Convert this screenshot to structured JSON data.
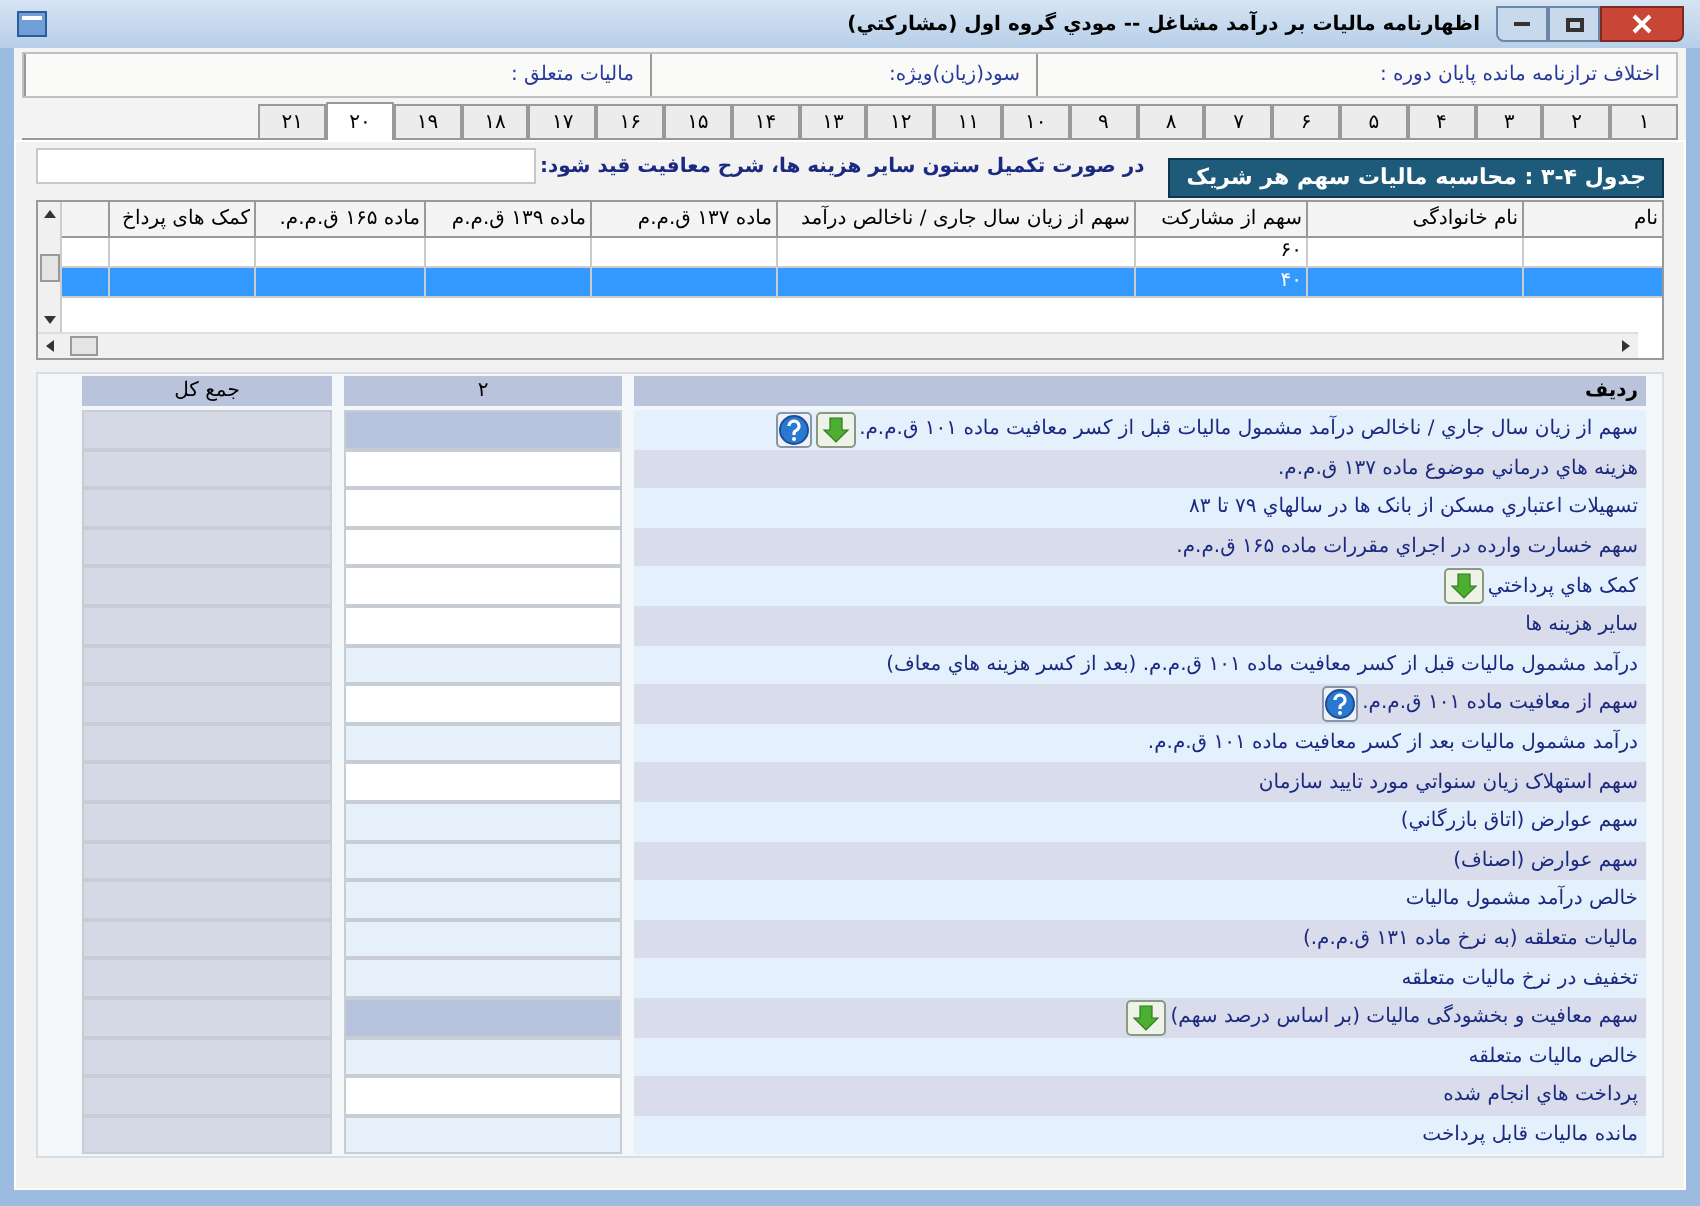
{
  "window": {
    "title": "اظهارنامه ماليات بر درآمد مشاغل -- مودي گروه اول (مشارکتي)"
  },
  "info_bar": [
    {
      "label": "اختلاف ترازنامه مانده پایان دوره :"
    },
    {
      "label": "سود(زیان)ویژه:"
    },
    {
      "label": "مالیات متعلق :"
    }
  ],
  "tabs": [
    {
      "label": "۱",
      "selected": false
    },
    {
      "label": "۲",
      "selected": false
    },
    {
      "label": "۳",
      "selected": false
    },
    {
      "label": "۴",
      "selected": false
    },
    {
      "label": "۵",
      "selected": false
    },
    {
      "label": "۶",
      "selected": false
    },
    {
      "label": "۷",
      "selected": false
    },
    {
      "label": "۸",
      "selected": false
    },
    {
      "label": "۹",
      "selected": false
    },
    {
      "label": "۱۰",
      "selected": false
    },
    {
      "label": "۱۱",
      "selected": false
    },
    {
      "label": "۱۲",
      "selected": false
    },
    {
      "label": "۱۳",
      "selected": false
    },
    {
      "label": "۱۴",
      "selected": false
    },
    {
      "label": "۱۵",
      "selected": false
    },
    {
      "label": "۱۶",
      "selected": false
    },
    {
      "label": "۱۷",
      "selected": false
    },
    {
      "label": "۱۸",
      "selected": false
    },
    {
      "label": "۱۹",
      "selected": false
    },
    {
      "label": "۲۰",
      "selected": true
    },
    {
      "label": "۲۱",
      "selected": false
    }
  ],
  "section": {
    "title": "جدول ۴-۳ : محاسبه مالیات سهم هر شریک",
    "note": "در صورت تکمیل ستون سایر هزینه ها، شرح معافیت قید شود:"
  },
  "partners_grid": {
    "columns": [
      "نام",
      "نام خانوادگی",
      "سهم از مشارکت",
      "سهم از زیان سال جاری / ناخالص درآمد",
      "ماده ۱۳۷ ق.م.م",
      "ماده ۱۳۹ ق.م.م",
      "ماده ۱۶۵ ق.م.م.",
      "کمک های پرداخ"
    ],
    "rows": [
      {
        "share": "۶۰",
        "selected": false
      },
      {
        "share": "۴۰",
        "selected": true
      }
    ]
  },
  "calc_table": {
    "columns": [
      "ردیف",
      "۲",
      "جمع کل"
    ],
    "rows": [
      {
        "label": "سهم از زیان سال جاري / ناخالص درآمد مشمول ماليات قبل از کسر معافيت ماده ۱۰۱ ق.م.م.",
        "down_button": true,
        "help_button": true,
        "kind": "locked"
      },
      {
        "label": "هزینه هاي درماني موضوع ماده ۱۳۷ ق.م.م.",
        "down_button": false,
        "help_button": false,
        "kind": "input"
      },
      {
        "label": "تسهیلات اعتباري مسکن از بانک ها در سالهاي ۷۹ تا ۸۳",
        "down_button": false,
        "help_button": false,
        "kind": "input"
      },
      {
        "label": "سهم خسارت وارده در اجراي مقررات ماده ۱۶۵ ق.م.م.",
        "down_button": false,
        "help_button": false,
        "kind": "input"
      },
      {
        "label": "کمک هاي پرداختي",
        "down_button": true,
        "help_button": false,
        "kind": "input"
      },
      {
        "label": "سایر هزینه ها",
        "down_button": false,
        "help_button": false,
        "kind": "input"
      },
      {
        "label": "درآمد مشمول ماليات قبل از کسر معافيت ماده ۱۰۱ ق.م.م. (بعد از کسر هزينه هاي معاف)",
        "down_button": false,
        "help_button": false,
        "kind": "computed"
      },
      {
        "label": "سهم از معافیت ماده ۱۰۱ ق.م.م.",
        "down_button": false,
        "help_button": true,
        "kind": "input"
      },
      {
        "label": "درآمد مشمول ماليات بعد از کسر معافيت ماده ۱۰۱ ق.م.م.",
        "down_button": false,
        "help_button": false,
        "kind": "computed"
      },
      {
        "label": "سهم استهلاک زیان سنواتي مورد تاييد سازمان",
        "down_button": false,
        "help_button": false,
        "kind": "input"
      },
      {
        "label": "سهم عوارض (اتاق بازرگاني)",
        "down_button": false,
        "help_button": false,
        "kind": "computed"
      },
      {
        "label": "سهم عوارض (اصناف)",
        "down_button": false,
        "help_button": false,
        "kind": "computed"
      },
      {
        "label": "خالص درآمد مشمول ماليات",
        "down_button": false,
        "help_button": false,
        "kind": "computed"
      },
      {
        "label": "ماليات متعلقه (به نرخ ماده ۱۳۱ ق.م.م.)",
        "down_button": false,
        "help_button": false,
        "kind": "computed"
      },
      {
        "label": "تخفیف در نرخ مالیات متعلقه",
        "down_button": false,
        "help_button": false,
        "kind": "computed"
      },
      {
        "label": "سهم معافیت و بخشودگی مالیات (بر اساس درصد سهم)",
        "down_button": true,
        "help_button": false,
        "kind": "locked"
      },
      {
        "label": "خالص ماليات متعلقه",
        "down_button": false,
        "help_button": false,
        "kind": "computed"
      },
      {
        "label": "پرداخت هاي انجام شده",
        "down_button": false,
        "help_button": false,
        "kind": "input"
      },
      {
        "label": "مانده ماليات قابل پرداخت",
        "down_button": false,
        "help_button": false,
        "kind": "computed"
      }
    ]
  }
}
